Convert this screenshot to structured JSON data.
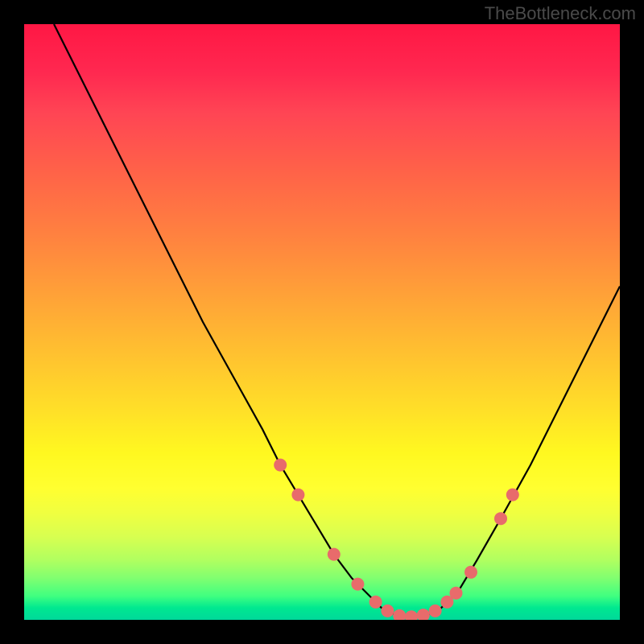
{
  "attribution": "TheBottleneck.com",
  "chart_data": {
    "type": "line",
    "title": "",
    "xlabel": "",
    "ylabel": "",
    "xlim": [
      0,
      100
    ],
    "ylim": [
      0,
      100
    ],
    "series": [
      {
        "name": "bottleneck-curve",
        "x": [
          5,
          10,
          15,
          20,
          25,
          30,
          35,
          40,
          43,
          46,
          49,
          52,
          55,
          58,
          60,
          62,
          64,
          66,
          68,
          70,
          73,
          76,
          80,
          85,
          90,
          95,
          100
        ],
        "y": [
          100,
          90,
          80,
          70,
          60,
          50,
          41,
          32,
          26,
          21,
          16,
          11,
          7,
          4,
          2,
          1,
          0.5,
          0.5,
          1,
          2,
          5,
          10,
          17,
          26,
          36,
          46,
          56
        ]
      }
    ],
    "markers": {
      "name": "highlight-points",
      "color": "#e86b6b",
      "points": [
        {
          "x": 43,
          "y": 26
        },
        {
          "x": 46,
          "y": 21
        },
        {
          "x": 52,
          "y": 11
        },
        {
          "x": 56,
          "y": 6
        },
        {
          "x": 59,
          "y": 3
        },
        {
          "x": 61,
          "y": 1.5
        },
        {
          "x": 63,
          "y": 0.7
        },
        {
          "x": 65,
          "y": 0.5
        },
        {
          "x": 67,
          "y": 0.8
        },
        {
          "x": 69,
          "y": 1.5
        },
        {
          "x": 71,
          "y": 3
        },
        {
          "x": 72.5,
          "y": 4.5
        },
        {
          "x": 75,
          "y": 8
        },
        {
          "x": 80,
          "y": 17
        },
        {
          "x": 82,
          "y": 21
        }
      ]
    }
  }
}
